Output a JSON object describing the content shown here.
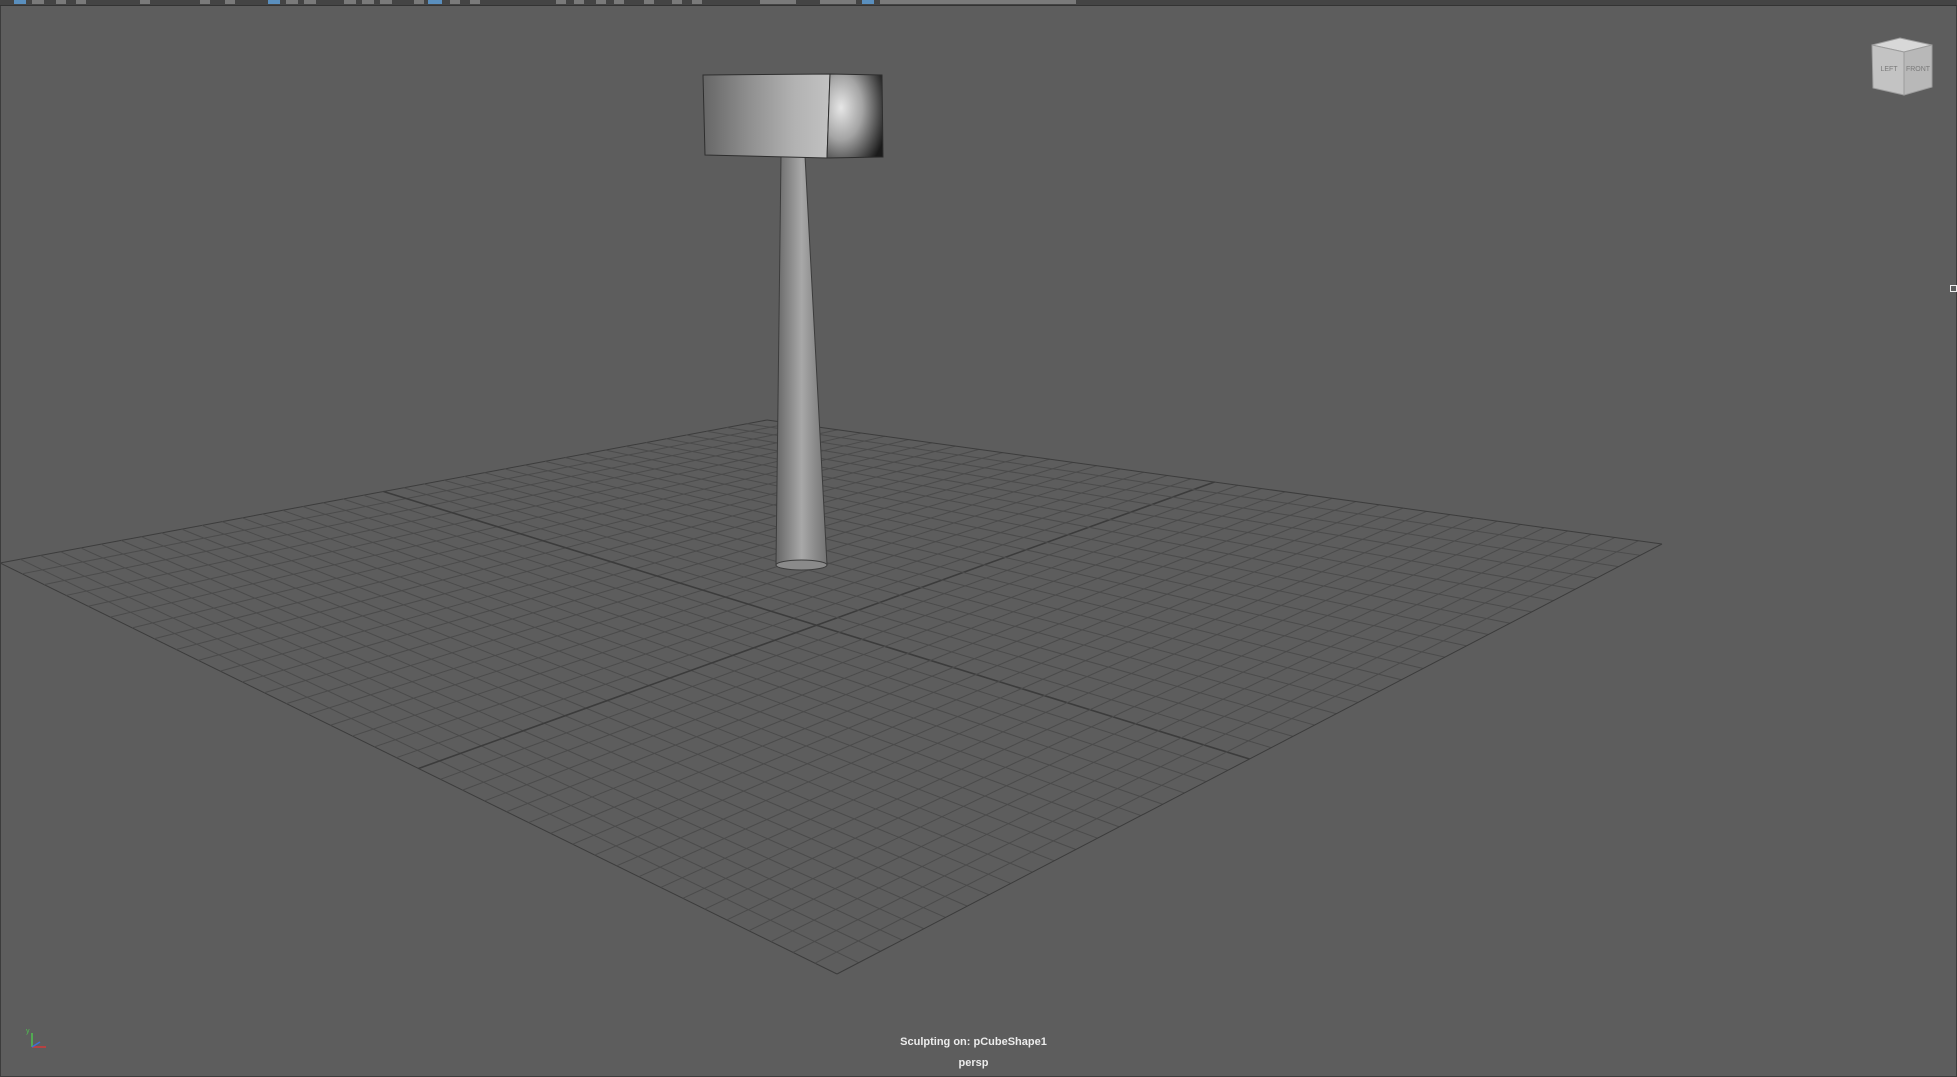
{
  "viewport": {
    "hud": {
      "sculpt_label": "Sculpting on: pCubeShape1",
      "camera_name": "persp"
    },
    "viewcube": {
      "left_face": "LEFT",
      "front_face": "FRONT"
    },
    "axis_indicator": {
      "y_label": "y",
      "x_color": "#d43a3a",
      "y_color": "#4fc34f",
      "z_color": "#3f6fd6"
    },
    "scene_objects": [
      {
        "name": "tapered-column",
        "type": "cylinder"
      },
      {
        "name": "pCubeShape1",
        "type": "cube"
      }
    ],
    "colors": {
      "background": "#5d5d5d",
      "grid_line": "#4b4b4b",
      "grid_major": "#3c3c3c",
      "highlight": "#5a8fbe"
    }
  }
}
